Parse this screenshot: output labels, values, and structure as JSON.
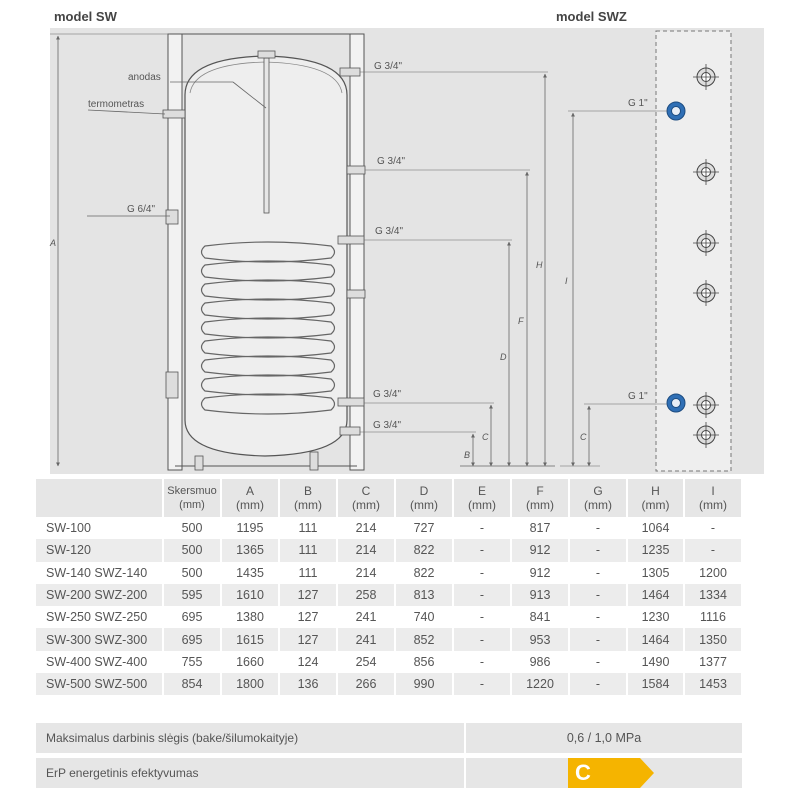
{
  "diagram": {
    "title_left": "model SW",
    "title_right": "model SWZ",
    "labels": {
      "anodas": "anodas",
      "termometras": "termometras",
      "g64": "G 6/4\"",
      "g34": "G 3/4\"",
      "g1": "G 1\""
    },
    "dims": {
      "a": "A",
      "b": "B",
      "c": "C",
      "d": "D",
      "f": "F",
      "h": "H",
      "i": "I"
    },
    "colors": {
      "accent_port": "#2f6fb5",
      "tank_fill": "#efefef",
      "panel_fill": "#eeeeee"
    }
  },
  "table": {
    "headers": [
      {
        "top": "",
        "bottom": ""
      },
      {
        "top": "Skersmuo",
        "bottom": "(mm)"
      },
      {
        "top": "A",
        "bottom": "(mm)"
      },
      {
        "top": "B",
        "bottom": "(mm)"
      },
      {
        "top": "C",
        "bottom": "(mm)"
      },
      {
        "top": "D",
        "bottom": "(mm)"
      },
      {
        "top": "E",
        "bottom": "(mm)"
      },
      {
        "top": "F",
        "bottom": "(mm)"
      },
      {
        "top": "G",
        "bottom": "(mm)"
      },
      {
        "top": "H",
        "bottom": "(mm)"
      },
      {
        "top": "I",
        "bottom": "(mm)"
      }
    ],
    "rows": [
      [
        "SW-100",
        "500",
        "1195",
        "111",
        "214",
        "727",
        "-",
        "817",
        "-",
        "1064",
        "-"
      ],
      [
        "SW-120",
        "500",
        "1365",
        "111",
        "214",
        "822",
        "-",
        "912",
        "-",
        "1235",
        "-"
      ],
      [
        "SW-140 SWZ-140",
        "500",
        "1435",
        "111",
        "214",
        "822",
        "-",
        "912",
        "-",
        "1305",
        "1200"
      ],
      [
        "SW-200 SWZ-200",
        "595",
        "1610",
        "127",
        "258",
        "813",
        "-",
        "913",
        "-",
        "1464",
        "1334"
      ],
      [
        "SW-250 SWZ-250",
        "695",
        "1380",
        "127",
        "241",
        "740",
        "-",
        "841",
        "-",
        "1230",
        "1116"
      ],
      [
        "SW-300 SWZ-300",
        "695",
        "1615",
        "127",
        "241",
        "852",
        "-",
        "953",
        "-",
        "1464",
        "1350"
      ],
      [
        "SW-400 SWZ-400",
        "755",
        "1660",
        "124",
        "254",
        "856",
        "-",
        "986",
        "-",
        "1490",
        "1377"
      ],
      [
        "SW-500 SWZ-500",
        "854",
        "1800",
        "136",
        "266",
        "990",
        "-",
        "1220",
        "-",
        "1584",
        "1453"
      ]
    ]
  },
  "footer": {
    "pressure_label": "Maksimalus darbinis slėgis (bake/šilumokaityje)",
    "pressure_value": "0,6 / 1,0 MPa",
    "erp_label": "ErP energetinis efektyvumas",
    "erp_class": "C",
    "erp_color": "#f5b400"
  }
}
